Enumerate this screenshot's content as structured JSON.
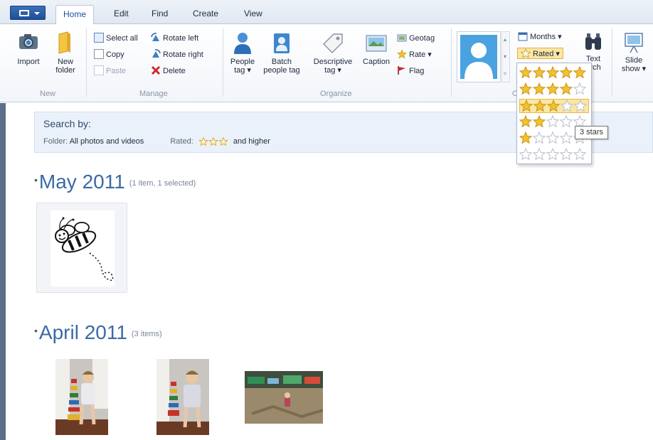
{
  "tabs": [
    "Home",
    "Edit",
    "Find",
    "Create",
    "View"
  ],
  "ribbon": {
    "new_group": {
      "import": "Import",
      "new_folder_1": "New",
      "new_folder_2": "folder",
      "label": "New"
    },
    "manage_group": {
      "select_all": "Select all",
      "copy": "Copy",
      "paste": "Paste",
      "rotate_left": "Rotate left",
      "rotate_right": "Rotate right",
      "delete": "Delete",
      "label": "Manage"
    },
    "organize_group": {
      "people_1": "People",
      "people_2": "tag ▾",
      "batch_1": "Batch",
      "batch_2": "people tag",
      "descriptive_1": "Descriptive",
      "descriptive_2": "tag ▾",
      "caption": "Caption",
      "geotag": "Geotag",
      "rate": "Rate ▾",
      "flag": "Flag",
      "label": "Organize"
    },
    "find_group": {
      "months": "Months ▾",
      "rated": "Rated ▾",
      "text_search_1": "Text",
      "text_search_2": "arch",
      "label": "C"
    },
    "slideshow_1": "Slide",
    "slideshow_2": "show ▾"
  },
  "rated_dropdown": {
    "options": [
      5,
      4,
      3,
      2,
      1,
      0
    ],
    "highlighted": 3,
    "tooltip": "3 stars"
  },
  "search": {
    "title": "Search by:",
    "folder_label": "Folder:",
    "folder_value": "All photos and videos",
    "rated_label": "Rated:",
    "rated_stars": 3,
    "rated_suffix": "and higher"
  },
  "sections": [
    {
      "title": "May 2011",
      "meta": "(1 item, 1 selected)"
    },
    {
      "title": "April 2011",
      "meta": "(3 items)"
    }
  ],
  "colors": {
    "accent": "#3b6aa6",
    "star": "#f2c12e",
    "highlight": "#fbe6a2"
  }
}
